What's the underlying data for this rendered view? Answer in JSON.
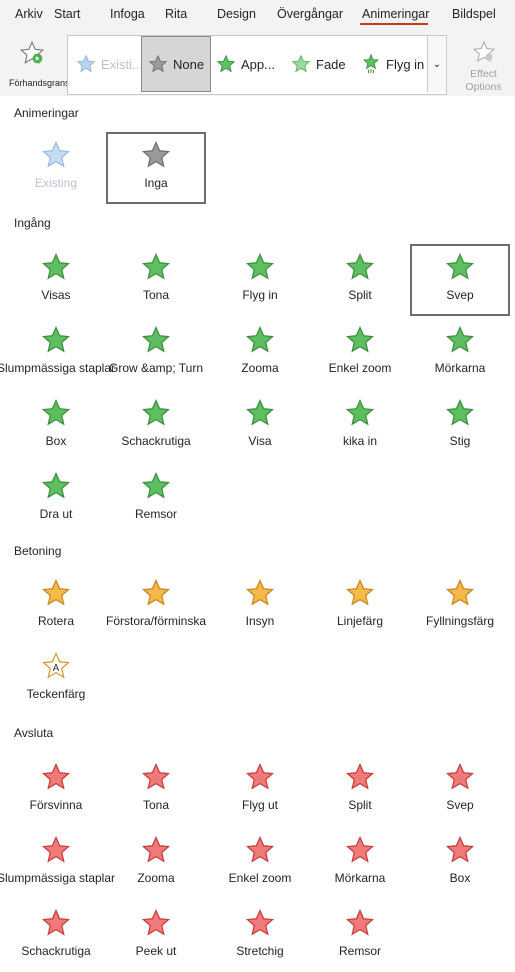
{
  "tabs": [
    "Arkiv",
    "Start",
    "Infoga",
    "Rita",
    "Design",
    "Övergångar",
    "Animeringar",
    "Bildspel"
  ],
  "ribbon": {
    "preview_label": "Förhandsgranska",
    "gallery": [
      "Existi...",
      "None",
      "App...",
      "Fade",
      "Flyg in"
    ],
    "scroll_glyph": "⌄",
    "effect_options": "Effect Options"
  },
  "colors": {
    "accent": "#c43e1c",
    "entrance": "#4caf50",
    "emphasis": "#f0a830",
    "exit": "#e04a4a",
    "none": "#8a8a8a"
  },
  "sections": [
    {
      "title": "Animeringar",
      "items": [
        {
          "label": "Existing",
          "kind": "existing",
          "selected": false,
          "disabled": true
        },
        {
          "label": "Inga",
          "kind": "none",
          "selected": true
        }
      ]
    },
    {
      "title": "Ingång",
      "items": [
        {
          "label": "Visas",
          "kind": "entrance"
        },
        {
          "label": "Tona",
          "kind": "entrance"
        },
        {
          "label": "Flyg in",
          "kind": "entrance"
        },
        {
          "label": "Split",
          "kind": "entrance"
        },
        {
          "label": "Svep",
          "kind": "entrance",
          "selected": true
        },
        {
          "label": "Slumpmässiga staplar",
          "kind": "entrance"
        },
        {
          "label": "Grow &amp; Turn",
          "kind": "entrance"
        },
        {
          "label": "Zooma",
          "kind": "entrance"
        },
        {
          "label": "Enkel zoom",
          "kind": "entrance"
        },
        {
          "label": "Mörkarna",
          "kind": "entrance"
        },
        {
          "label": "Box",
          "kind": "entrance"
        },
        {
          "label": "Schackrutiga",
          "kind": "entrance"
        },
        {
          "label": "Visa",
          "kind": "entrance"
        },
        {
          "label": "kika in",
          "kind": "entrance"
        },
        {
          "label": "Stig",
          "kind": "entrance"
        },
        {
          "label": "Dra ut",
          "kind": "entrance"
        },
        {
          "label": "Remsor",
          "kind": "entrance"
        }
      ]
    },
    {
      "title": "Betoning",
      "items": [
        {
          "label": "Rotera",
          "kind": "emphasis"
        },
        {
          "label": "Förstora/förminska",
          "kind": "emphasis"
        },
        {
          "label": "Insyn",
          "kind": "emphasis"
        },
        {
          "label": "Linjefärg",
          "kind": "emphasis"
        },
        {
          "label": "Fyllningsfärg",
          "kind": "emphasis"
        },
        {
          "label": "Teckenfärg",
          "kind": "emphasis-letter"
        }
      ]
    },
    {
      "title": "Avsluta",
      "items": [
        {
          "label": "Försvinna",
          "kind": "exit"
        },
        {
          "label": "Tona",
          "kind": "exit"
        },
        {
          "label": "Flyg ut",
          "kind": "exit"
        },
        {
          "label": "Split",
          "kind": "exit"
        },
        {
          "label": "Svep",
          "kind": "exit"
        },
        {
          "label": "Slumpmässiga staplar",
          "kind": "exit"
        },
        {
          "label": "Zooma",
          "kind": "exit"
        },
        {
          "label": "Enkel zoom",
          "kind": "exit"
        },
        {
          "label": "Mörkarna",
          "kind": "exit"
        },
        {
          "label": "Box",
          "kind": "exit"
        },
        {
          "label": "Schackrutiga",
          "kind": "exit"
        },
        {
          "label": "Peek ut",
          "kind": "exit"
        },
        {
          "label": "Stretchig",
          "kind": "exit"
        },
        {
          "label": "Remsor",
          "kind": "exit"
        }
      ]
    }
  ]
}
